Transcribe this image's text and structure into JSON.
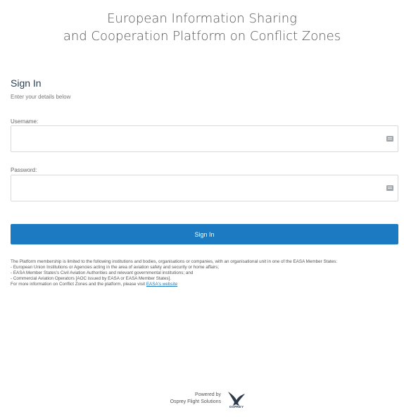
{
  "header": {
    "title_line1": "European Information Sharing",
    "title_line2": "and Cooperation Platform on Conflict Zones"
  },
  "signin": {
    "heading": "Sign In",
    "subtitle": "Enter your details below",
    "username_label": "Username:",
    "username_value": "",
    "password_label": "Password:",
    "password_value": "",
    "button_label": "Sign In"
  },
  "info": {
    "line1": "The Platform membership is limited to the following institutions and bodies, organisations or companies, with an organisational unit in one of the EASA Member States:",
    "line2": "- European Union Institutions or Agencies acting in the area of aviation safety and security or home affairs;",
    "line3": "- EASA Member States's Civil Aviation Authorities and relevant governmental institutions; and",
    "line4": "- Commercial Aviation Operators [AOC issued by EASA or EASA Member States].",
    "line5_prefix": "For more information on Conflict Zones and the platform, please visit ",
    "link_text": "EASA's website"
  },
  "footer": {
    "powered_by": "Powered by",
    "company": "Osprey Flight Solutions",
    "logo_text": "OSPREY"
  },
  "icons": {
    "field_icon": "keyboard-icon",
    "logo": "osprey-bird-logo"
  },
  "colors": {
    "accent": "#1c7ac2",
    "title_text": "#555555"
  }
}
